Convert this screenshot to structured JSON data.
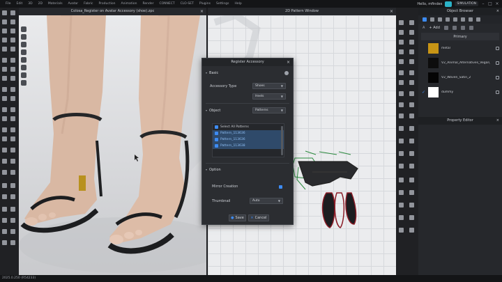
{
  "menubar": {
    "items": [
      "File",
      "Edit",
      "3D",
      "2D",
      "Materials",
      "Avatar",
      "Fabric",
      "Production",
      "Animation",
      "Render",
      "CONNECT",
      "CLO-SET",
      "Plugins",
      "Settings",
      "Help"
    ],
    "user": "Hello, mfindes",
    "mode": "SIMULATION"
  },
  "window_3d": {
    "title": "Colosa_Register on Avatar Accessory (shoe).zpc"
  },
  "window_2d": {
    "title": "2D Pattern Window"
  },
  "object_browser": {
    "title": "Object Browser",
    "add_label": "+ Add",
    "group_label": "Primary",
    "items": [
      {
        "name": "metal",
        "color": "#c89515"
      },
      {
        "name": "V2_Animal_Alternatives_Vegan_Leather",
        "color": "#0d0d0d"
      },
      {
        "name": "V2_Woven_Satin_2",
        "color": "#050505"
      },
      {
        "name": "dummy",
        "color": "#ffffff"
      }
    ]
  },
  "property_editor": {
    "title": "Property Editor"
  },
  "dialog": {
    "title": "Register Accessory",
    "basic": {
      "heading": "Basic",
      "accessory_type_label": "Accessory Type",
      "accessory_type_value": "Shoes",
      "subtype_value": "Heels"
    },
    "object": {
      "heading": "Object",
      "object_value": "Patterns",
      "select_all_label": "Select All Patterns",
      "patterns": [
        "Pattern_113636",
        "Pattern_113636",
        "Pattern_113638"
      ]
    },
    "option": {
      "heading": "Option",
      "mirror_label": "Mirror Creation",
      "thumbnail_label": "Thumbnail",
      "thumbnail_value": "Auto"
    },
    "save_label": "Save",
    "cancel_label": "Cancel"
  },
  "status": {
    "version": "2025.0.250 (R54233)"
  }
}
